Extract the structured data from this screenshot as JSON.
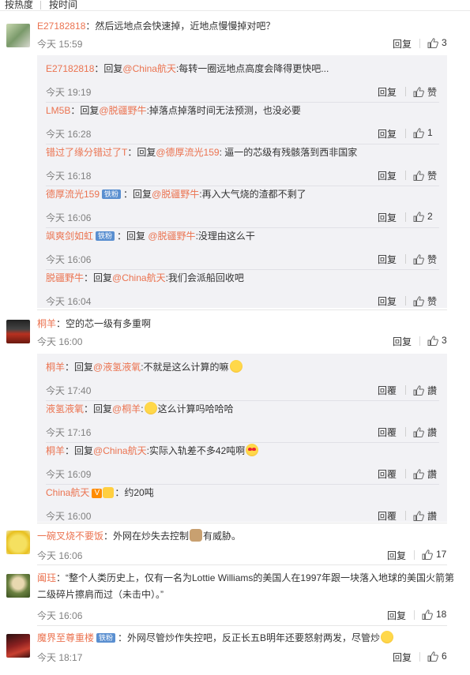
{
  "sort": {
    "hot": "按热度",
    "time": "按时间"
  },
  "labels": {
    "reply": "回复",
    "like_zan": "赞",
    "reply_trad": "回覆",
    "like_trad": "讚"
  },
  "comments": [
    {
      "user": "E27182818",
      "text": "：然后远地点会快速掉，近地点慢慢掉对吧？",
      "time": "今天 15:59",
      "likes": "3",
      "replies": [
        {
          "user": "E27182818",
          "pre": "：回复",
          "to": "@China航天",
          "text": ":每转一圈远地点高度会降得更快吧...",
          "time": "今天 19:19",
          "likes": "赞"
        },
        {
          "user": "LM5B",
          "pre": "：回复",
          "to": "@脱疆野牛",
          "text": ":掉落点掉落时间无法预测，也没必要",
          "time": "今天 16:28",
          "likes": "1"
        },
        {
          "user": "错过了缘分错过了T",
          "pre": "：回复",
          "to": "@德厚流光159",
          "text": ": 逼一的芯级有残骸落到西非国家",
          "time": "今天 16:18",
          "likes": "赞"
        },
        {
          "user": "德厚流光159",
          "badge": "铁粉",
          "pre": "：回复",
          "to": "@脱疆野牛",
          "text": ":再入大气烧的渣都不剩了",
          "time": "今天 16:06",
          "likes": "2"
        },
        {
          "user": "飒爽剑如虹",
          "badge": "铁粉",
          "pre": "：回复 ",
          "to": "@脱疆野牛",
          "text": ":没理由这么干",
          "time": "今天 16:06",
          "likes": "赞"
        },
        {
          "user": "脱疆野牛",
          "pre": "：回复",
          "to": "@China航天",
          "text": ":我们会派船回收吧",
          "time": "今天 16:04",
          "likes": "赞"
        }
      ]
    },
    {
      "user": "桐羊",
      "text": "：空的芯一级有多重啊",
      "time": "今天 16:00",
      "likes": "3",
      "replies": [
        {
          "user": "桐羊",
          "pre": "：回复",
          "to": "@液氢液氧",
          "text": ":不就是这么计算的嘛",
          "time": "今天 17:40",
          "likes": "讚"
        },
        {
          "user": "液氢液氧",
          "pre": "：回复",
          "to": "@桐羊",
          "text": ":",
          "text2": "这么计算吗哈哈哈",
          "time": "今天 17:16",
          "likes": "讚"
        },
        {
          "user": "桐羊",
          "pre": "：回复",
          "to": "@China航天",
          "text": ":实际入轨差不多42吨啊",
          "time": "今天 16:09",
          "likes": "讚"
        },
        {
          "user": "China航天",
          "pre": "：",
          "to": "",
          "text": "约20吨",
          "time": "今天 16:00",
          "likes": "讚"
        }
      ]
    },
    {
      "user": "一碗叉烧不要饭",
      "text": "：外网在炒失去控制",
      "text2": "有威胁。",
      "time": "今天 16:06",
      "likes": "17"
    },
    {
      "user": "阖珏",
      "text": "：“整个人类历史上，仅有一名为Lottie Williams的美国人在1997年跟一块落入地球的美国火箭第二级碎片擦肩而过（未击中）。”",
      "time": "今天 16:06",
      "likes": "18"
    },
    {
      "user": "魔界至尊重楼",
      "badge": "铁粉",
      "text": "：外网尽管炒作失控吧，反正长五B明年还要怒射两发，尽管炒",
      "time": "今天 18:17",
      "likes": "6"
    }
  ],
  "colors": {
    "username": "#eb7350",
    "time": "#808080",
    "reply_bg": "#f2f2f5",
    "badge": "#5a8fd0"
  },
  "icons": [
    "thumb-up-icon",
    "vip-icon",
    "laugh-emoji-icon",
    "heart-eyes-emoji-icon",
    "cat-emoji-icon"
  ]
}
